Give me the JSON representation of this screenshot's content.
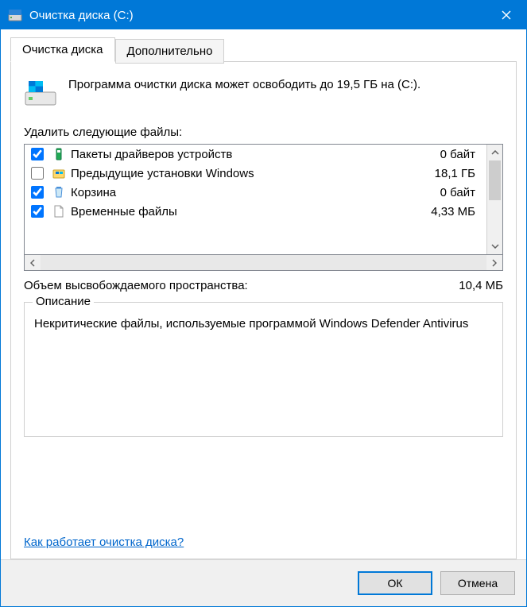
{
  "title": "Очистка диска  (C:)",
  "tabs": {
    "active": "Очистка диска",
    "other": "Дополнительно"
  },
  "intro": "Программа очистки диска может освободить до 19,5 ГБ на  (C:).",
  "files_label": "Удалить следующие файлы:",
  "files": [
    {
      "checked": true,
      "icon": "driver",
      "name": "Пакеты драйверов устройств",
      "size": "0 байт"
    },
    {
      "checked": false,
      "icon": "windows",
      "name": "Предыдущие установки Windows",
      "size": "18,1 ГБ"
    },
    {
      "checked": true,
      "icon": "recycle",
      "name": "Корзина",
      "size": "0 байт"
    },
    {
      "checked": true,
      "icon": "file",
      "name": "Временные файлы",
      "size": "4,33 МБ"
    }
  ],
  "total_label": "Объем высвобождаемого пространства:",
  "total_value": "10,4 МБ",
  "description_label": "Описание",
  "description_text": "Некритические файлы, используемые программой Windows Defender Antivirus",
  "help_link": "Как работает очистка диска?",
  "buttons": {
    "ok": "ОК",
    "cancel": "Отмена"
  }
}
